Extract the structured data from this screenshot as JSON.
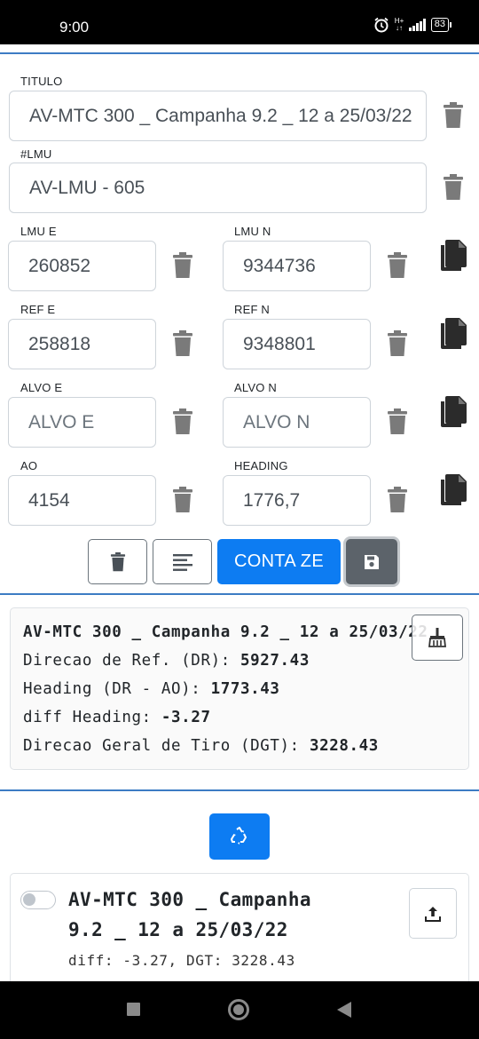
{
  "status_bar": {
    "time": "9:00",
    "battery": "83"
  },
  "form": {
    "titulo": {
      "label": "TITULO",
      "value": "AV-MTC 300 _ Campanha 9.2 _ 12 a 25/03/22"
    },
    "lmu": {
      "label": "#LMU",
      "value": "AV-LMU - 605"
    },
    "lmu_e": {
      "label": "LMU E",
      "value": "260852"
    },
    "lmu_n": {
      "label": "LMU N",
      "value": "9344736"
    },
    "ref_e": {
      "label": "REF E",
      "value": "258818"
    },
    "ref_n": {
      "label": "REF N",
      "value": "9348801"
    },
    "alvo_e": {
      "label": "ALVO E",
      "placeholder": "ALVO E"
    },
    "alvo_n": {
      "label": "ALVO N",
      "placeholder": "ALVO N"
    },
    "ao": {
      "label": "AO",
      "value": "4154"
    },
    "heading": {
      "label": "HEADING",
      "value": "1776,7"
    }
  },
  "actions": {
    "conta_label": "CONTA ZE"
  },
  "result": {
    "title": "AV-MTC 300 _ Campanha 9.2 _ 12 a 25/03/22",
    "dr_label": "Direcao de Ref. (DR): ",
    "dr_value": "5927.43",
    "heading_label": "Heading (DR - AO): ",
    "heading_value": "1773.43",
    "diff_label": "diff Heading: ",
    "diff_value": "-3.27",
    "dgt_label": "Direcao Geral de Tiro (DGT): ",
    "dgt_value": "3228.43"
  },
  "saved": {
    "title_line1": "AV-MTC 300 _ Campanha",
    "title_line2": "9.2 _ 12 a 25/03/22",
    "summary": "diff: -3.27, DGT: 3228.43"
  }
}
